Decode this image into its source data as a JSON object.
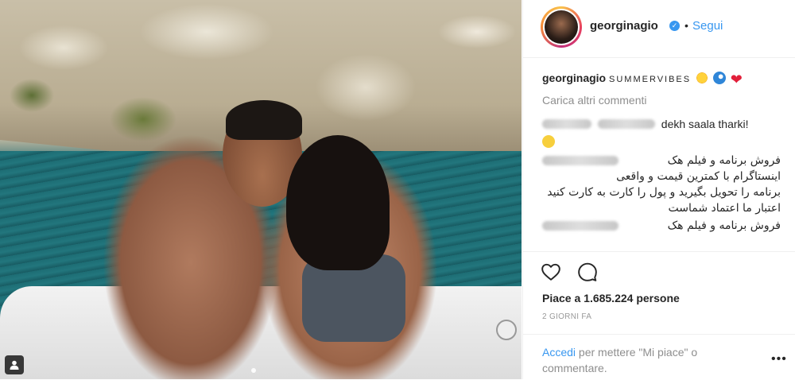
{
  "post": {
    "username": "georginagio",
    "verified_mark": "✓",
    "separator": "•",
    "follow_label": "Segui"
  },
  "caption": {
    "username": "georginagio",
    "text": "SUMMERVIBES",
    "emoji_heart": "❤"
  },
  "comments": {
    "load_more_label": "Carica altri commenti",
    "items": [
      {
        "text": "dekh saala tharki!"
      },
      {
        "text": "فروش برنامه و فیلم هک\nاینستاگرام با کمترین قیمت و واقعی\nبرنامه را تحویل بگیرید و پول را کارت به کارت کنید\nاعتبار ما اعتماد شماست"
      },
      {
        "text": "فروش برنامه و فیلم هک"
      }
    ]
  },
  "actions": {
    "likes_text": "Piace a 1.685.224 persone",
    "timestamp": "2 GIORNI FA"
  },
  "login_prompt": {
    "link_label": "Accedi",
    "text": " per mettere \"Mi piace\" o commentare.",
    "more_label": "•••"
  },
  "icons": {
    "heart": "heart-icon",
    "comment": "comment-icon",
    "verified": "verified-badge-icon",
    "profile_tag": "user-tag-icon"
  },
  "colors": {
    "link_blue": "#3897f0",
    "text": "#262626",
    "muted": "#8e8e8e",
    "border": "#efefef"
  }
}
